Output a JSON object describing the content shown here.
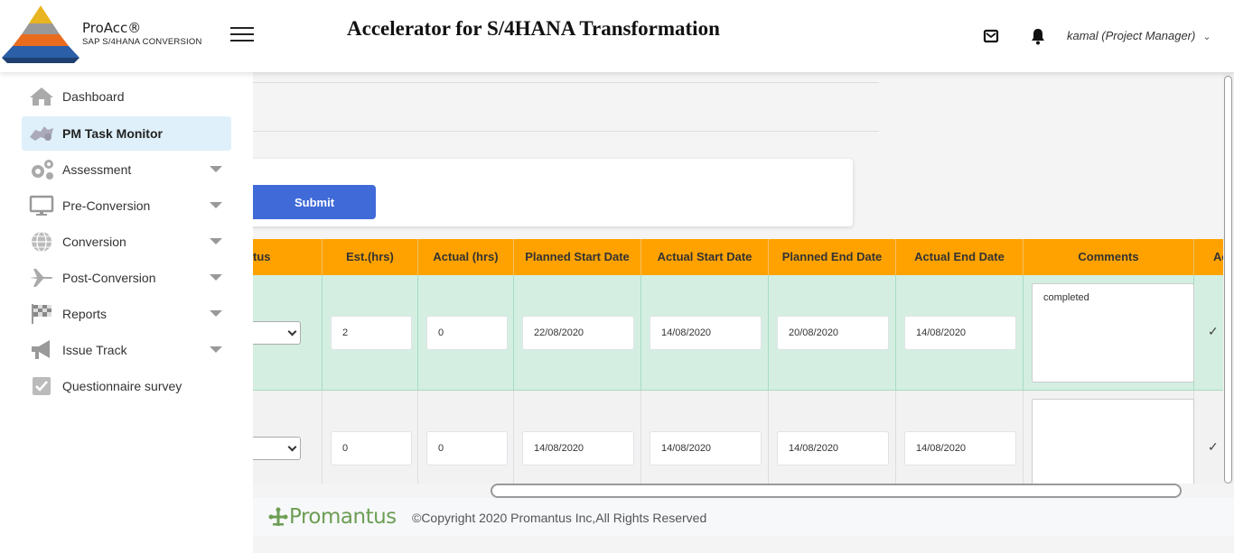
{
  "header": {
    "brand_name": "ProAcc®",
    "brand_sub": "SAP S/4HANA CONVERSION",
    "app_title": "Accelerator for S/4HANA Transformation",
    "user": "kamal (Project Manager)",
    "icons": [
      "menu-icon",
      "mail-icon",
      "bell-icon",
      "chevron-down-icon"
    ]
  },
  "sidebar": {
    "items": [
      {
        "label": "Dashboard",
        "icon": "home-icon",
        "expandable": false,
        "active": false
      },
      {
        "label": "PM Task Monitor",
        "icon": "task-monitor-icon",
        "expandable": false,
        "active": true
      },
      {
        "label": "Assessment",
        "icon": "gears-icon",
        "expandable": true,
        "active": false
      },
      {
        "label": "Pre-Conversion",
        "icon": "monitor-icon",
        "expandable": true,
        "active": false
      },
      {
        "label": "Conversion",
        "icon": "globe-icon",
        "expandable": true,
        "active": false
      },
      {
        "label": "Post-Conversion",
        "icon": "plane-icon",
        "expandable": true,
        "active": false
      },
      {
        "label": "Reports",
        "icon": "checkered-flag-icon",
        "expandable": true,
        "active": false
      },
      {
        "label": "Issue Track",
        "icon": "megaphone-icon",
        "expandable": true,
        "active": false
      },
      {
        "label": "Questionnaire survey",
        "icon": "checkbox-icon",
        "expandable": false,
        "active": false
      }
    ]
  },
  "form": {
    "submit_label": "Submit"
  },
  "table": {
    "columns": [
      "tus",
      "Est.(hrs)",
      "Actual (hrs)",
      "Planned Start Date",
      "Actual Start Date",
      "Planned End Date",
      "Actual End Date",
      "Comments",
      "Ac"
    ],
    "rows": [
      {
        "est": "2",
        "actual": "0",
        "planned_start": "22/08/2020",
        "actual_start": "14/08/2020",
        "planned_end": "20/08/2020",
        "actual_end": "14/08/2020",
        "comment": "completed",
        "action": "✓"
      },
      {
        "est": "0",
        "actual": "0",
        "planned_start": "14/08/2020",
        "actual_start": "14/08/2020",
        "planned_end": "14/08/2020",
        "actual_end": "14/08/2020",
        "comment": "",
        "action": "✓"
      }
    ]
  },
  "footer": {
    "logo_text": "Promantus",
    "copyright": "©Copyright 2020 Promantus Inc,All Rights Reserved"
  },
  "colors": {
    "header_orange": "#ffa200",
    "row_green": "#d4efe2",
    "submit_blue": "#3f6ad8",
    "active_nav": "#dff0fa",
    "footer_green": "#6c9e54"
  }
}
